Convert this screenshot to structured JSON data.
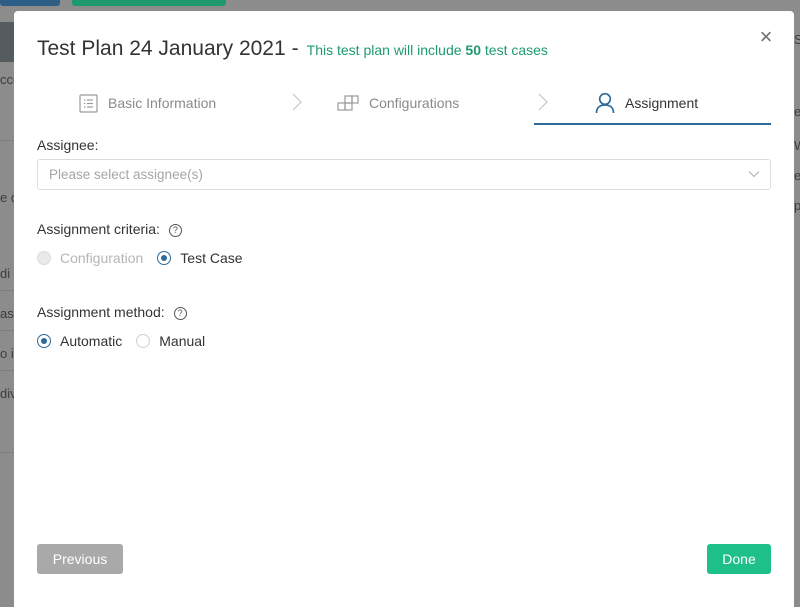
{
  "background": {
    "fragments": [
      "cco",
      "e d",
      "di",
      "as",
      "o i",
      "div"
    ],
    "right_fragments": [
      "S",
      "",
      "e",
      "W",
      "e",
      "p"
    ]
  },
  "modal": {
    "title": "Test Plan 24 January 2021",
    "dash": "-",
    "note_prefix": "This test plan will include",
    "note_count": "50",
    "note_suffix": "test cases",
    "close_glyph": "×"
  },
  "steps": [
    {
      "label": "Basic Information",
      "icon": "list-icon"
    },
    {
      "label": "Configurations",
      "icon": "blocks-icon"
    },
    {
      "label": "Assignment",
      "icon": "user-icon",
      "active": true
    }
  ],
  "assignee": {
    "label": "Assignee:",
    "placeholder": "Please select assignee(s)"
  },
  "criteria": {
    "label": "Assignment criteria:",
    "help": "?",
    "options": [
      {
        "label": "Configuration",
        "disabled": true,
        "checked": false
      },
      {
        "label": "Test Case",
        "disabled": false,
        "checked": true
      }
    ]
  },
  "method": {
    "label": "Assignment method:",
    "help": "?",
    "options": [
      {
        "label": "Automatic",
        "checked": true
      },
      {
        "label": "Manual",
        "checked": false
      }
    ]
  },
  "footer": {
    "previous": "Previous",
    "done": "Done"
  },
  "colors": {
    "accent": "#2f6b9a",
    "success": "#1ec08a",
    "note": "#1f9a6d"
  }
}
